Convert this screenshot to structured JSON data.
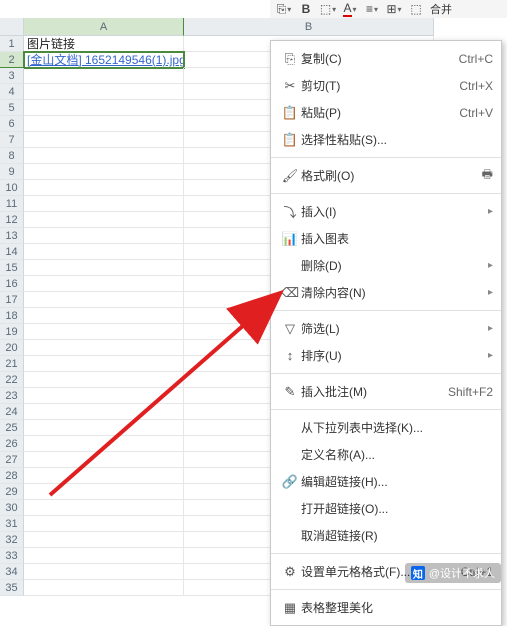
{
  "toolbar": {
    "merge_label": "合并"
  },
  "columns": {
    "A": "A",
    "B": "B"
  },
  "rows": {
    "count": 35,
    "r1": {
      "A": "图片链接"
    },
    "r2": {
      "A": "[金山文档] 1652149546(1).jpg"
    }
  },
  "selection": {
    "row": 2,
    "col": "A"
  },
  "contextMenu": [
    {
      "type": "item",
      "icon": "copy-icon",
      "label": "复制(C)",
      "shortcut": "Ctrl+C"
    },
    {
      "type": "item",
      "icon": "cut-icon",
      "label": "剪切(T)",
      "shortcut": "Ctrl+X"
    },
    {
      "type": "item",
      "icon": "paste-icon",
      "label": "粘贴(P)",
      "shortcut": "Ctrl+V"
    },
    {
      "type": "item",
      "icon": "paste-sp-icon",
      "label": "选择性粘贴(S)...",
      "shortcut": ""
    },
    {
      "type": "sep"
    },
    {
      "type": "item",
      "icon": "brush-icon",
      "label": "格式刷(O)",
      "shortcut": "",
      "tail": "printer-icon"
    },
    {
      "type": "sep"
    },
    {
      "type": "item",
      "icon": "insert-icon",
      "label": "插入(I)",
      "shortcut": "",
      "sub": "›"
    },
    {
      "type": "item",
      "icon": "chart-icon",
      "label": "插入图表",
      "shortcut": ""
    },
    {
      "type": "item",
      "icon": "",
      "label": "删除(D)",
      "shortcut": "",
      "sub": "›"
    },
    {
      "type": "item",
      "icon": "erase-icon",
      "label": "清除内容(N)",
      "shortcut": "",
      "sub": "›"
    },
    {
      "type": "sep"
    },
    {
      "type": "item",
      "icon": "filter-icon",
      "label": "筛选(L)",
      "shortcut": "",
      "sub": "›"
    },
    {
      "type": "item",
      "icon": "sort-icon",
      "label": "排序(U)",
      "shortcut": "",
      "sub": "›"
    },
    {
      "type": "sep"
    },
    {
      "type": "item",
      "icon": "comment-icon",
      "label": "插入批注(M)",
      "shortcut": "Shift+F2"
    },
    {
      "type": "sep"
    },
    {
      "type": "item",
      "icon": "",
      "label": "从下拉列表中选择(K)...",
      "shortcut": ""
    },
    {
      "type": "item",
      "icon": "",
      "label": "定义名称(A)...",
      "shortcut": ""
    },
    {
      "type": "item",
      "icon": "link-icon",
      "label": "编辑超链接(H)...",
      "shortcut": ""
    },
    {
      "type": "item",
      "icon": "",
      "label": "打开超链接(O)...",
      "shortcut": ""
    },
    {
      "type": "item",
      "icon": "",
      "label": "取消超链接(R)",
      "shortcut": ""
    },
    {
      "type": "sep"
    },
    {
      "type": "item",
      "icon": "format-icon",
      "label": "设置单元格格式(F)...",
      "shortcut": "Ctrl+1"
    },
    {
      "type": "sep"
    },
    {
      "type": "item",
      "icon": "table-icon",
      "label": "表格整理美化",
      "shortcut": ""
    }
  ],
  "watermark": {
    "brand": "知",
    "text": "@设计不求人"
  }
}
